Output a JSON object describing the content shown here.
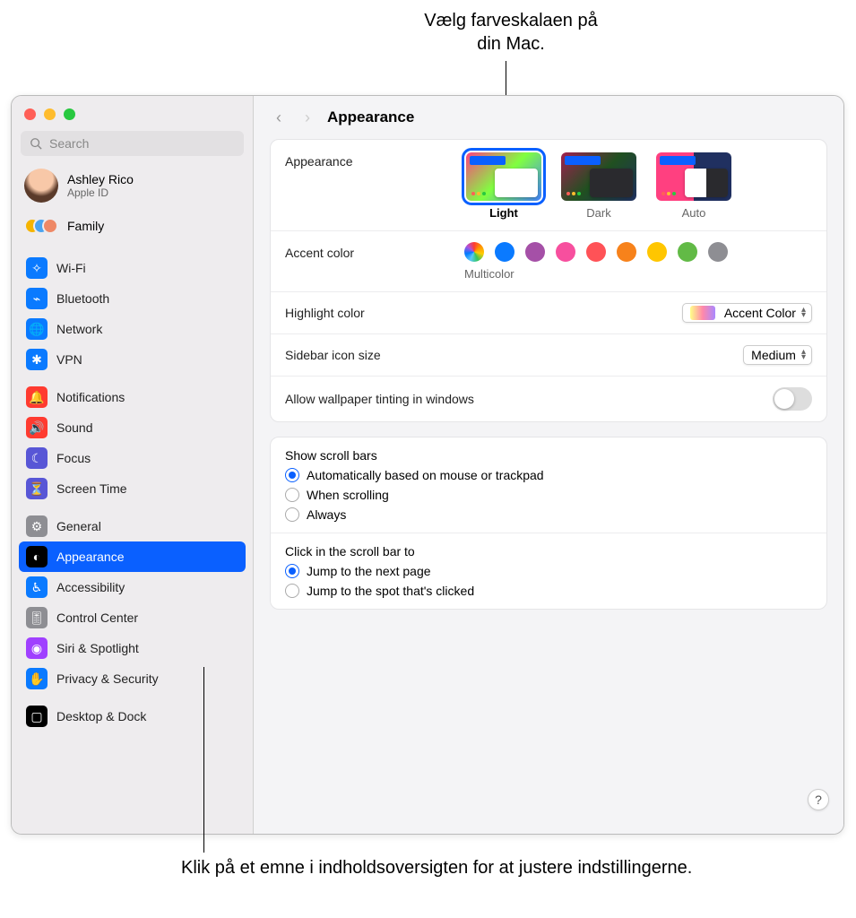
{
  "callouts": {
    "top": "Vælg farveskalaen på din Mac.",
    "bottom": "Klik på et emne i indholdsoversigten for at justere indstillingerne."
  },
  "search": {
    "placeholder": "Search"
  },
  "user": {
    "name": "Ashley Rico",
    "sub": "Apple ID"
  },
  "family": {
    "label": "Family"
  },
  "sidebar": {
    "groups": [
      [
        {
          "label": "Wi-Fi",
          "color": "#0a7aff",
          "glyph": "✧"
        },
        {
          "label": "Bluetooth",
          "color": "#0a7aff",
          "glyph": "⌁"
        },
        {
          "label": "Network",
          "color": "#0a7aff",
          "glyph": "🌐"
        },
        {
          "label": "VPN",
          "color": "#0a7aff",
          "glyph": "✱"
        }
      ],
      [
        {
          "label": "Notifications",
          "color": "#ff3b30",
          "glyph": "🔔"
        },
        {
          "label": "Sound",
          "color": "#ff3b30",
          "glyph": "🔊"
        },
        {
          "label": "Focus",
          "color": "#5856d6",
          "glyph": "☾"
        },
        {
          "label": "Screen Time",
          "color": "#5856d6",
          "glyph": "⏳"
        }
      ],
      [
        {
          "label": "General",
          "color": "#8e8e93",
          "glyph": "⚙"
        },
        {
          "label": "Appearance",
          "color": "#000",
          "glyph": "◐",
          "selected": true
        },
        {
          "label": "Accessibility",
          "color": "#0a7aff",
          "glyph": "♿︎"
        },
        {
          "label": "Control Center",
          "color": "#8e8e93",
          "glyph": "🎚"
        },
        {
          "label": "Siri & Spotlight",
          "color": "#a040ff",
          "glyph": "◉"
        },
        {
          "label": "Privacy & Security",
          "color": "#0a7aff",
          "glyph": "✋"
        }
      ],
      [
        {
          "label": "Desktop & Dock",
          "color": "#000",
          "glyph": "▢"
        }
      ]
    ]
  },
  "header": {
    "title": "Appearance"
  },
  "appearance": {
    "label": "Appearance",
    "options": [
      {
        "name": "Light",
        "selected": true
      },
      {
        "name": "Dark"
      },
      {
        "name": "Auto"
      }
    ]
  },
  "accent": {
    "label": "Accent color",
    "selected_label": "Multicolor",
    "colors": [
      "multi",
      "#0a7aff",
      "#a550a7",
      "#f74f9e",
      "#ff5257",
      "#f7821b",
      "#ffc600",
      "#62ba46",
      "#8e8e93"
    ]
  },
  "highlight": {
    "label": "Highlight color",
    "value": "Accent Color"
  },
  "sidebar_size": {
    "label": "Sidebar icon size",
    "value": "Medium"
  },
  "tinting": {
    "label": "Allow wallpaper tinting in windows"
  },
  "scrollbars": {
    "title": "Show scroll bars",
    "options": [
      {
        "label": "Automatically based on mouse or trackpad",
        "checked": true
      },
      {
        "label": "When scrolling"
      },
      {
        "label": "Always"
      }
    ]
  },
  "click_scroll": {
    "title": "Click in the scroll bar to",
    "options": [
      {
        "label": "Jump to the next page",
        "checked": true
      },
      {
        "label": "Jump to the spot that's clicked"
      }
    ]
  },
  "help": "?"
}
